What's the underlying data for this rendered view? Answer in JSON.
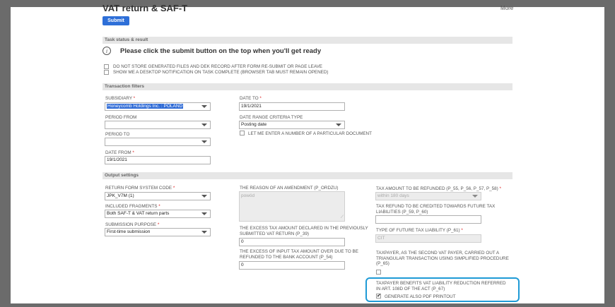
{
  "header": {
    "title": "VAT return & SAF-T",
    "more_label": "More",
    "submit_label": "Submit"
  },
  "sections": {
    "task_status": "Task status & result",
    "transaction_filters": "Transaction filters",
    "output_settings": "Output settings"
  },
  "task": {
    "info_icon": "i",
    "message": "Please click the submit button on the top when you'll get ready",
    "option_no_store": "DO NOT STORE GENERATED FILES AND DEK RECORD AFTER FORM RE-SUBMIT OR PAGE LEAVE",
    "option_notify": "SHOW ME A DESKTOP NOTIFICATION ON TASK COMPLETE (BROWSER TAB MUST REMAIN OPENED)"
  },
  "filters": {
    "subsidiary_label": "SUBSIDIARY",
    "subsidiary_value": "Honeycomb Holdings Inc. : POLAND",
    "period_from_label": "PERIOD FROM",
    "period_from_value": "",
    "period_to_label": "PERIOD TO",
    "period_to_value": "",
    "date_from_label": "DATE FROM",
    "date_from_value": "19/1/2021",
    "date_to_label": "DATE TO",
    "date_to_value": "19/1/2021",
    "date_range_label": "DATE RANGE CRITERIA TYPE",
    "date_range_value": "Posting date",
    "doc_number_label": "LET ME ENTER A NUMBER OF A PARTICULAR DOCUMENT"
  },
  "output": {
    "return_code_label": "RETURN FORM SYSTEM CODE",
    "return_code_value": "JPK_V7M (1)",
    "fragments_label": "INCLUDED FRAGMENTS",
    "fragments_value": "Both SAF-T & VAT return parts",
    "purpose_label": "SUBMISSION PURPOSE",
    "purpose_value": "First-time submission",
    "amendment_label": "THE REASON OF AN AMENDMENT (P_ORDZU)",
    "amendment_placeholder": "powód",
    "excess_tax_label_1": "THE EXCESS TAX AMOUNT DECLARED IN THE PREVIOUSLY",
    "excess_tax_label_2": "SUBMITTED VAT RETURN (P_39)",
    "excess_tax_value": "0",
    "excess_input_label_1": "THE EXCESS OF INPUT TAX AMOUNT OVER DUE TO BE",
    "excess_input_label_2": "REFUNDED TO THE BANK ACCOUNT (P_54)",
    "excess_input_value": "0",
    "refund_label": "TAX AMOUNT TO BE REFUNDED (P_55, P_56, P_57, P_58)",
    "refund_value": "within 180 days",
    "credited_label_1": "TAX REFUND TO BE CREDITED TOWARDS FUTURE TAX",
    "credited_label_2": "LIABILITIES (P_59, P_60)",
    "credited_value": "",
    "future_type_label": "TYPE OF FUTURE TAX LIABILITY (P_61)",
    "future_type_value": "CIT",
    "second_payer_label_1": "TAXPAYER, AS THE SECOND VAT PAYER, CARRIED OUT A",
    "second_payer_label_2": "TRIANGULAR TRANSACTION USING SIMPLIFIED PROCEDURE",
    "second_payer_label_3": "(P_65)",
    "benefits_label_1": "TAXPAYER BENEFITS VAT LIABILITY REDUCTION REFERRED",
    "benefits_label_2": "IN ART. 108D OF THE ACT (P_67)",
    "generate_pdf_label": "GENERATE ALSO PDF PRINTOUT",
    "checkmark": "✔"
  },
  "required_mark": "*"
}
